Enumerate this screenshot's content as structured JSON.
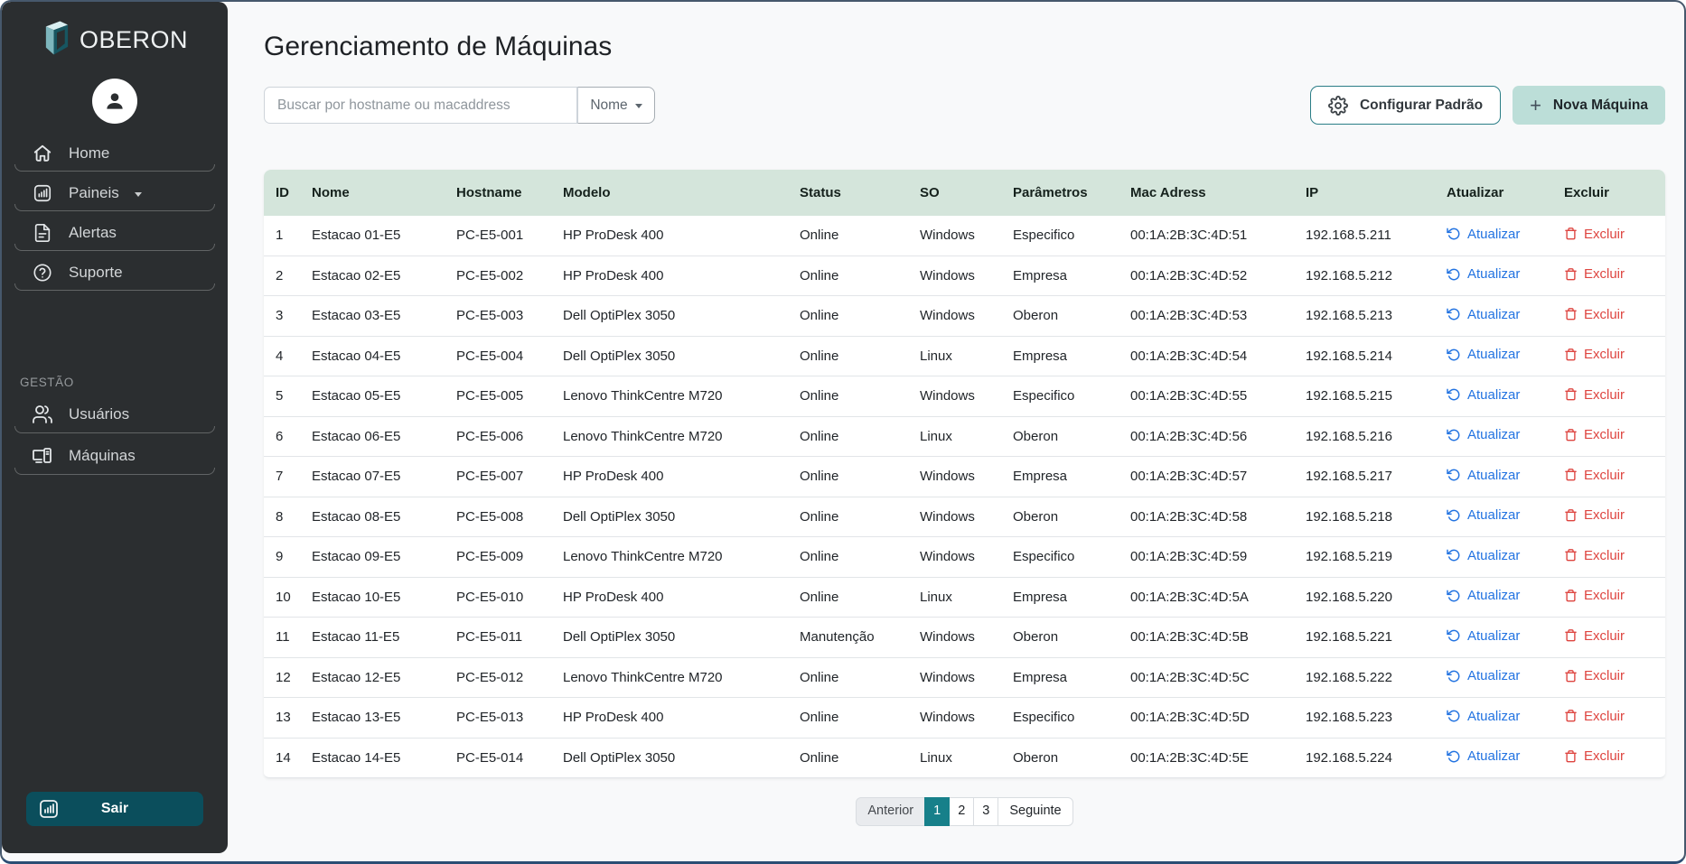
{
  "app": {
    "page_title": "Gerenciamento de Máquinas"
  },
  "sidebar": {
    "brand": "OBERON",
    "items": [
      {
        "label": "Home"
      },
      {
        "label": "Paineis",
        "has_caret": true
      },
      {
        "label": "Alertas"
      },
      {
        "label": "Suporte"
      }
    ],
    "section_label": "GESTÃO",
    "management_items": [
      {
        "label": "Usuários"
      },
      {
        "label": "Máquinas"
      }
    ],
    "logout_label": "Sair"
  },
  "toolbar": {
    "search_placeholder": "Buscar por hostname ou macaddress",
    "search_value": "",
    "filter_label": "Nome",
    "configure_label": "Configurar Padrão",
    "new_machine_label": "Nova Máquina"
  },
  "table": {
    "columns": [
      "ID",
      "Nome",
      "Hostname",
      "Modelo",
      "Status",
      "SO",
      "Parâmetros",
      "Mac Adress",
      "IP",
      "Atualizar",
      "Excluir"
    ],
    "update_label": "Atualizar",
    "delete_label": "Excluir",
    "machines": [
      {
        "id": "1",
        "nome": "Estacao 01-E5",
        "hostname": "PC-E5-001",
        "modelo": "HP ProDesk 400",
        "status": "Online",
        "so": "Windows",
        "parametros": "Especifico",
        "mac": "00:1A:2B:3C:4D:51",
        "ip": "192.168.5.211"
      },
      {
        "id": "2",
        "nome": "Estacao 02-E5",
        "hostname": "PC-E5-002",
        "modelo": "HP ProDesk 400",
        "status": "Online",
        "so": "Windows",
        "parametros": "Empresa",
        "mac": "00:1A:2B:3C:4D:52",
        "ip": "192.168.5.212"
      },
      {
        "id": "3",
        "nome": "Estacao 03-E5",
        "hostname": "PC-E5-003",
        "modelo": "Dell OptiPlex 3050",
        "status": "Online",
        "so": "Windows",
        "parametros": "Oberon",
        "mac": "00:1A:2B:3C:4D:53",
        "ip": "192.168.5.213"
      },
      {
        "id": "4",
        "nome": "Estacao 04-E5",
        "hostname": "PC-E5-004",
        "modelo": "Dell OptiPlex 3050",
        "status": "Online",
        "so": "Linux",
        "parametros": "Empresa",
        "mac": "00:1A:2B:3C:4D:54",
        "ip": "192.168.5.214"
      },
      {
        "id": "5",
        "nome": "Estacao 05-E5",
        "hostname": "PC-E5-005",
        "modelo": "Lenovo ThinkCentre M720",
        "status": "Online",
        "so": "Windows",
        "parametros": "Especifico",
        "mac": "00:1A:2B:3C:4D:55",
        "ip": "192.168.5.215"
      },
      {
        "id": "6",
        "nome": "Estacao 06-E5",
        "hostname": "PC-E5-006",
        "modelo": "Lenovo ThinkCentre M720",
        "status": "Online",
        "so": "Linux",
        "parametros": "Oberon",
        "mac": "00:1A:2B:3C:4D:56",
        "ip": "192.168.5.216"
      },
      {
        "id": "7",
        "nome": "Estacao 07-E5",
        "hostname": "PC-E5-007",
        "modelo": "HP ProDesk 400",
        "status": "Online",
        "so": "Windows",
        "parametros": "Empresa",
        "mac": "00:1A:2B:3C:4D:57",
        "ip": "192.168.5.217"
      },
      {
        "id": "8",
        "nome": "Estacao 08-E5",
        "hostname": "PC-E5-008",
        "modelo": "Dell OptiPlex 3050",
        "status": "Online",
        "so": "Windows",
        "parametros": "Oberon",
        "mac": "00:1A:2B:3C:4D:58",
        "ip": "192.168.5.218"
      },
      {
        "id": "9",
        "nome": "Estacao 09-E5",
        "hostname": "PC-E5-009",
        "modelo": "Lenovo ThinkCentre M720",
        "status": "Online",
        "so": "Windows",
        "parametros": "Especifico",
        "mac": "00:1A:2B:3C:4D:59",
        "ip": "192.168.5.219"
      },
      {
        "id": "10",
        "nome": "Estacao 10-E5",
        "hostname": "PC-E5-010",
        "modelo": "HP ProDesk 400",
        "status": "Online",
        "so": "Linux",
        "parametros": "Empresa",
        "mac": "00:1A:2B:3C:4D:5A",
        "ip": "192.168.5.220"
      },
      {
        "id": "11",
        "nome": "Estacao 11-E5",
        "hostname": "PC-E5-011",
        "modelo": "Dell OptiPlex 3050",
        "status": "Manutenção",
        "so": "Windows",
        "parametros": "Oberon",
        "mac": "00:1A:2B:3C:4D:5B",
        "ip": "192.168.5.221"
      },
      {
        "id": "12",
        "nome": "Estacao 12-E5",
        "hostname": "PC-E5-012",
        "modelo": "Lenovo ThinkCentre M720",
        "status": "Online",
        "so": "Windows",
        "parametros": "Empresa",
        "mac": "00:1A:2B:3C:4D:5C",
        "ip": "192.168.5.222"
      },
      {
        "id": "13",
        "nome": "Estacao 13-E5",
        "hostname": "PC-E5-013",
        "modelo": "HP ProDesk 400",
        "status": "Online",
        "so": "Windows",
        "parametros": "Especifico",
        "mac": "00:1A:2B:3C:4D:5D",
        "ip": "192.168.5.223"
      },
      {
        "id": "14",
        "nome": "Estacao 14-E5",
        "hostname": "PC-E5-014",
        "modelo": "Dell OptiPlex 3050",
        "status": "Online",
        "so": "Linux",
        "parametros": "Oberon",
        "mac": "00:1A:2B:3C:4D:5E",
        "ip": "192.168.5.224"
      }
    ]
  },
  "pagination": {
    "previous_label": "Anterior",
    "pages": [
      {
        "label": "1",
        "active": true
      },
      {
        "label": "2",
        "active": false
      },
      {
        "label": "3",
        "active": false
      }
    ],
    "next_label": "Seguinte"
  },
  "colors": {
    "sidebar_bg": "#2b2e30",
    "accent_teal": "#17808a",
    "logout_bg": "#0b4e5c",
    "table_header_bg": "#d4e5db",
    "new_button_bg": "#bcded8",
    "update_link": "#2273e1",
    "delete_link": "#de4540"
  }
}
